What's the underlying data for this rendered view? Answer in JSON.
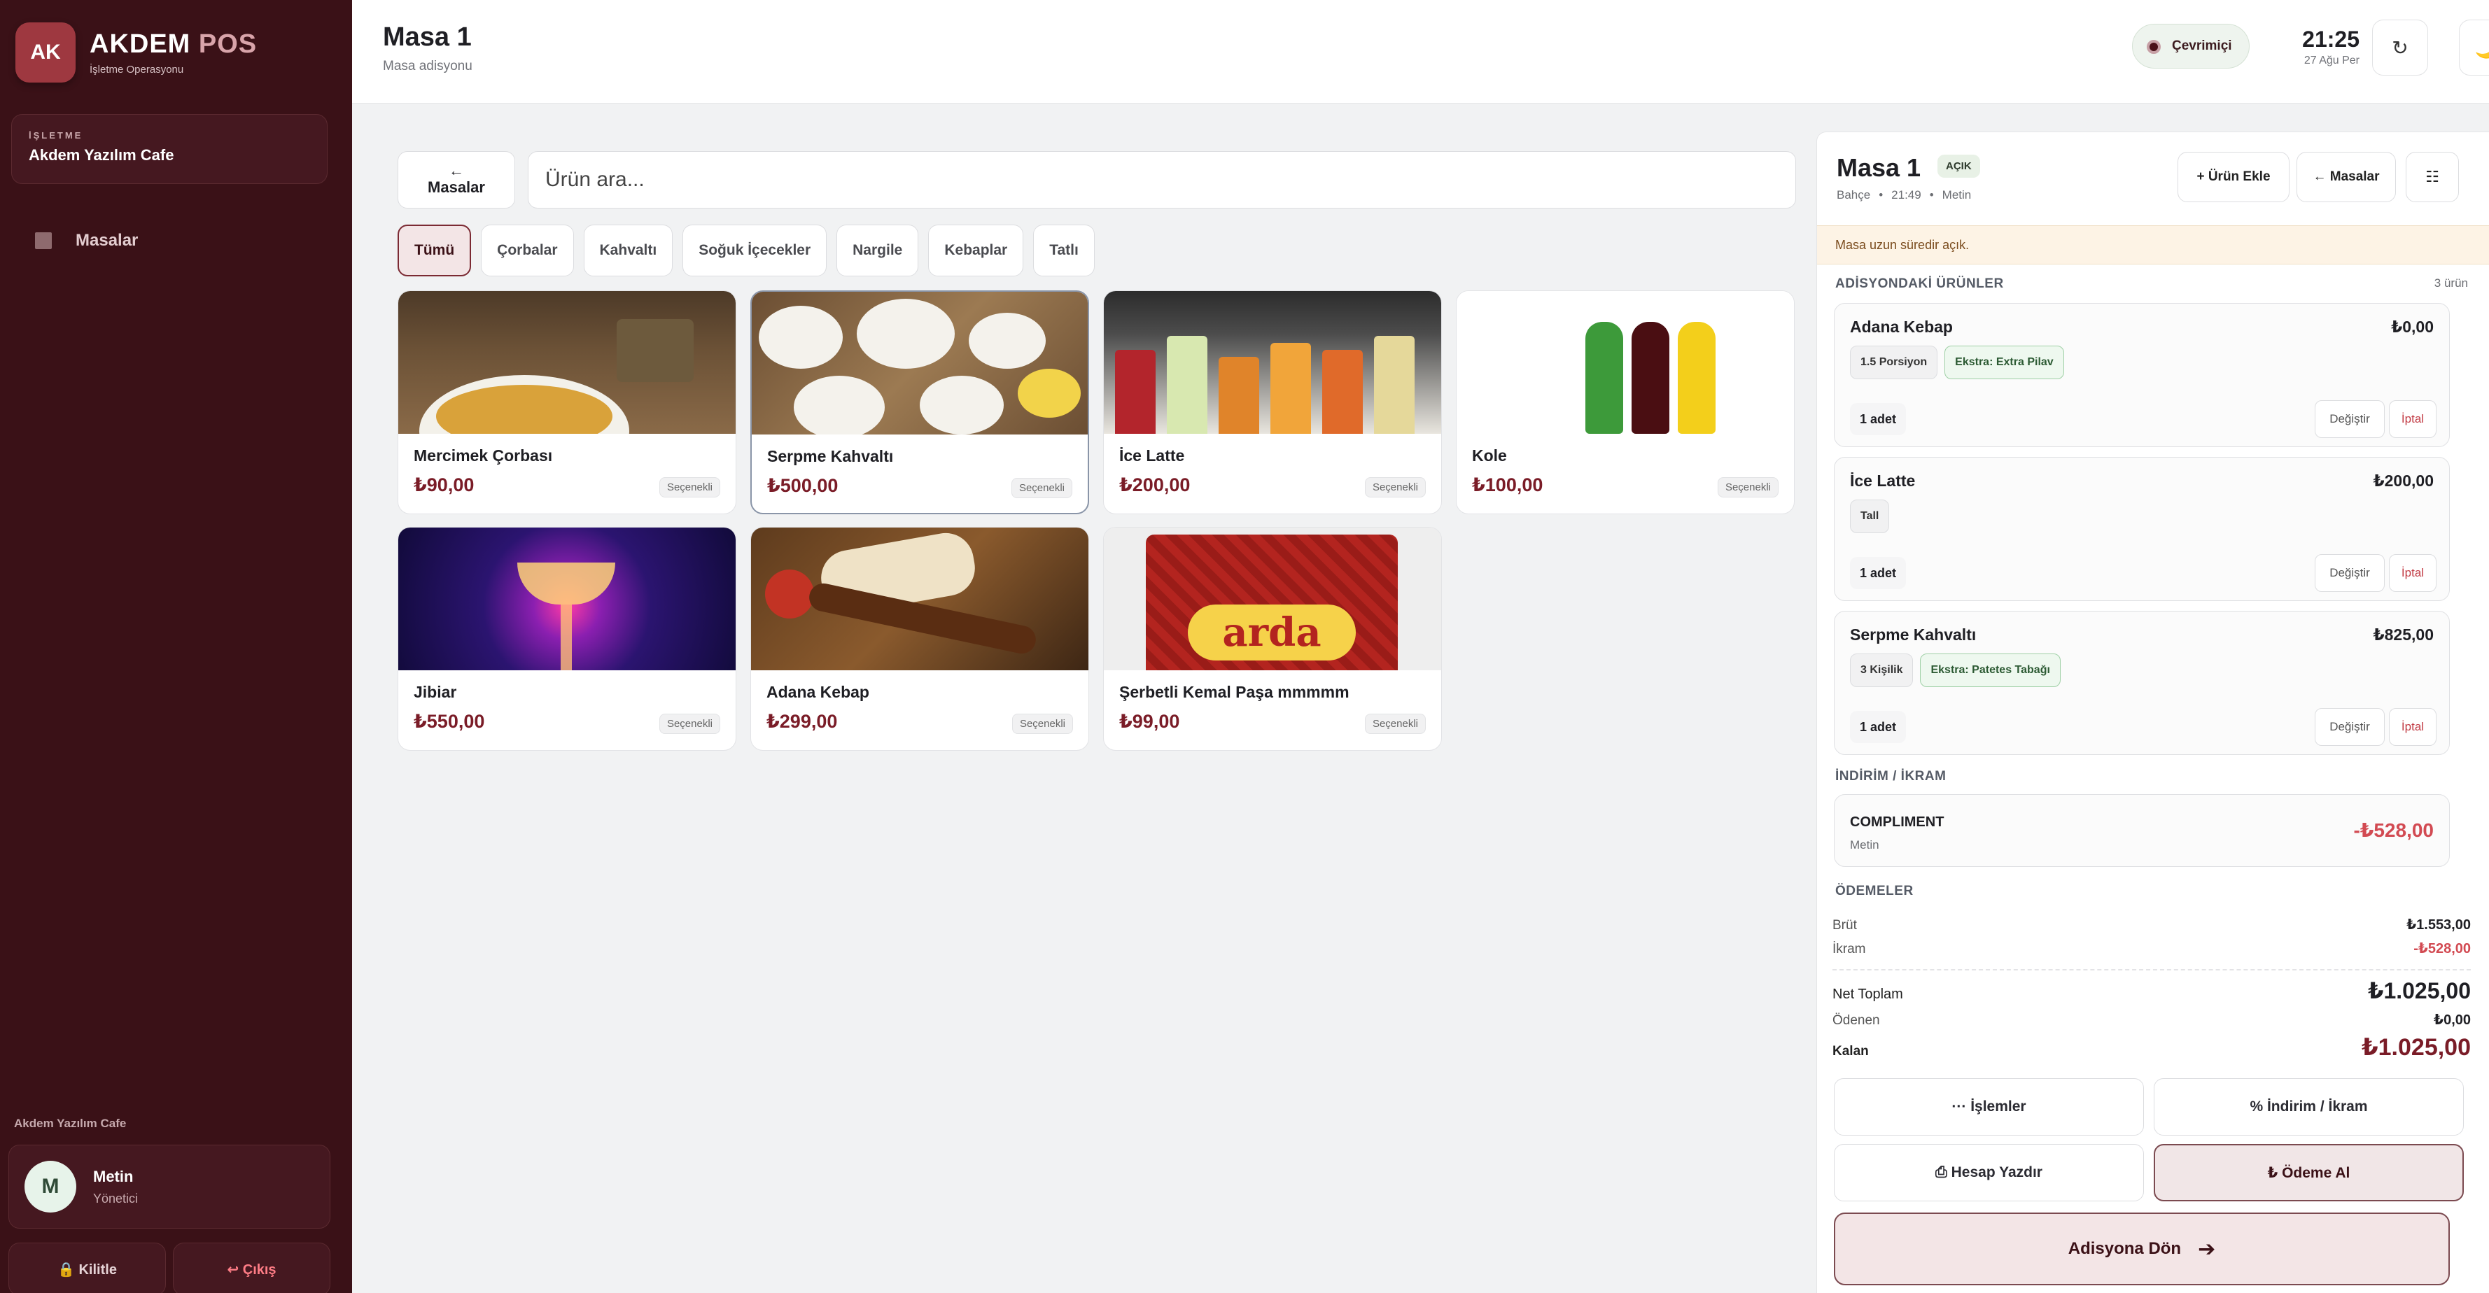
{
  "sidebar": {
    "logo": "AK",
    "brand_main": "AKDEM",
    "brand_accent": "POS",
    "brand_sub": "İşletme Operasyonu",
    "business_label": "İŞLETME",
    "business_name": "Akdem Yazılım Cafe",
    "nav": [
      {
        "label": "Masalar",
        "icon": "grid-icon"
      }
    ],
    "footer_business": "Akdem Yazılım Cafe",
    "user": {
      "initial": "M",
      "name": "Metin",
      "role": "Yönetici"
    },
    "lock_label": "🔒 Kilitle",
    "logout_label": "↩ Çıkış"
  },
  "header": {
    "title": "Masa 1",
    "subtitle": "Masa adisyonu",
    "status": "Çevrimiçi",
    "time": "21:25",
    "date": "27 Ağu Per",
    "refresh_icon": "↻",
    "theme_icon": "🌙"
  },
  "toolbar": {
    "back_arrow": "←",
    "back_label": "Masalar",
    "search_placeholder": "Ürün ara..."
  },
  "categories": [
    "Tümü",
    "Çorbalar",
    "Kahvaltı",
    "Soğuk İçecekler",
    "Nargile",
    "Kebaplar",
    "Tatlı"
  ],
  "active_category": "Tümü",
  "products": [
    {
      "name": "Mercimek Çorbası",
      "price": "₺90,00",
      "tag": "Seçenekli"
    },
    {
      "name": "Serpme Kahvaltı",
      "price": "₺500,00",
      "tag": "Seçenekli"
    },
    {
      "name": "İce Latte",
      "price": "₺200,00",
      "tag": "Seçenekli"
    },
    {
      "name": "Kole",
      "price": "₺100,00",
      "tag": "Seçenekli"
    },
    {
      "name": "Jibiar",
      "price": "₺550,00",
      "tag": "Seçenekli"
    },
    {
      "name": "Adana Kebap",
      "price": "₺299,00",
      "tag": "Seçenekli"
    },
    {
      "name": "Şerbetli Kemal Paşa mmmmm",
      "price": "₺99,00",
      "tag": "Seçenekli"
    }
  ],
  "product_image_text": {
    "arda": "arda"
  },
  "order": {
    "title": "Masa 1",
    "status_badge": "AÇIK",
    "meta": [
      "Bahçe",
      "•",
      "21:49",
      "•",
      "Metin"
    ],
    "add_btn": "+ Ürün Ekle",
    "tables_btn": "← Masalar",
    "menu_icon": "☷",
    "warning": "Masa uzun süredir açık.",
    "items_title": "ADİSYONDAKİ ÜRÜNLER",
    "items_count": "3 ürün",
    "items": [
      {
        "name": "Adana Kebap",
        "price": "₺0,00",
        "chips": [
          {
            "text": "1.5 Porsiyon",
            "extra": false
          },
          {
            "text": "Ekstra:  Extra Pilav",
            "extra": true
          }
        ],
        "qty": "1 adet",
        "change": "Değiştir",
        "cancel": "İptal"
      },
      {
        "name": "İce Latte",
        "price": "₺200,00",
        "chips": [
          {
            "text": "Tall",
            "extra": false
          }
        ],
        "qty": "1 adet",
        "change": "Değiştir",
        "cancel": "İptal"
      },
      {
        "name": "Serpme Kahvaltı",
        "price": "₺825,00",
        "chips": [
          {
            "text": "3 Kişilik",
            "extra": false
          },
          {
            "text": "Ekstra:  Patetes Tabağı",
            "extra": true
          }
        ],
        "qty": "1 adet",
        "change": "Değiştir",
        "cancel": "İptal"
      }
    ],
    "discount_title": "İNDİRİM / İKRAM",
    "discount": {
      "name": "COMPLIMENT",
      "by": "Metin",
      "amount": "-₺528,00"
    },
    "payments_title": "ÖDEMELER",
    "summary": {
      "gross_label": "Brüt",
      "gross": "₺1.553,00",
      "comp_label": "İkram",
      "comp": "-₺528,00",
      "net_label": "Net Toplam",
      "net": "₺1.025,00",
      "paid_label": "Ödenen",
      "paid": "₺0,00",
      "due_label": "Kalan",
      "due": "₺1.025,00"
    },
    "actions": {
      "ops": "··· İşlemler",
      "discount": "% İndirim / İkram",
      "print": "⎙ Hesap Yazdır",
      "pay": "₺ Ödeme Al"
    },
    "return_label": "Adisyona Dön",
    "return_arrow": "➔"
  },
  "colors": {
    "sidebar": "#3a1117",
    "accent": "#7a1c27",
    "danger": "#d24a52",
    "extra_chip": "#2c5a33"
  }
}
